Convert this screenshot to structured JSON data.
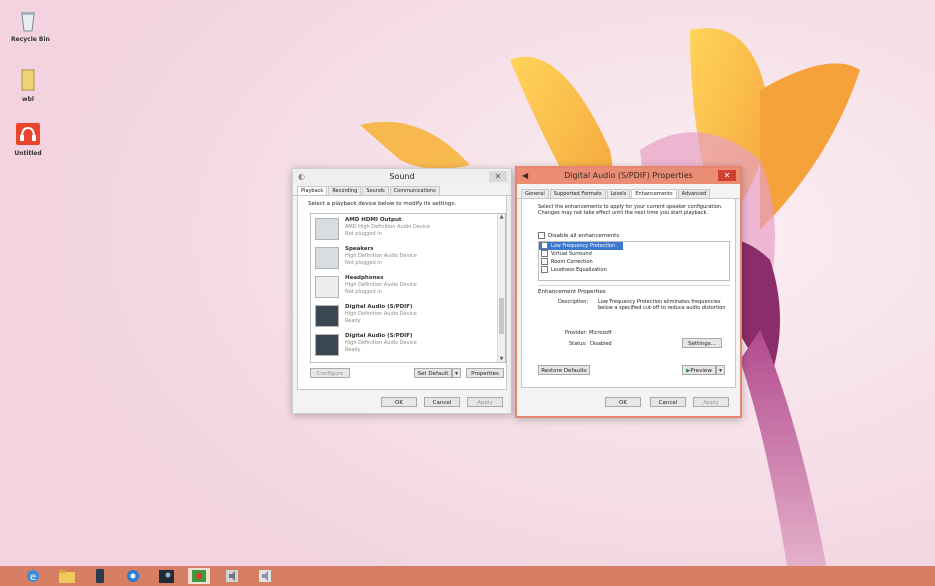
{
  "desktop": {
    "icons": [
      {
        "label": "Recycle Bin",
        "icon": "recycle-bin-icon"
      },
      {
        "label": "wbl",
        "icon": "folder-icon"
      },
      {
        "label": "Untitled",
        "icon": "headphones-app-icon"
      }
    ]
  },
  "sound": {
    "title": "Sound",
    "close_label": "✕",
    "tabs": [
      "Playback",
      "Recording",
      "Sounds",
      "Communications"
    ],
    "instruction": "Select a playback device below to modify its settings:",
    "devices": [
      {
        "name": "AMD HDMI Output",
        "desc": "AMD High Definition Audio Device",
        "status": "Not plugged in",
        "icon": "monitor-icon"
      },
      {
        "name": "Speakers",
        "desc": "High Definition Audio Device",
        "status": "Not plugged in",
        "icon": "speaker-icon"
      },
      {
        "name": "Headphones",
        "desc": "High Definition Audio Device",
        "status": "Not plugged in",
        "icon": "headphones-icon"
      },
      {
        "name": "Digital Audio (S/PDIF)",
        "desc": "High Definition Audio Device",
        "status": "Ready",
        "icon": "spdif-icon"
      },
      {
        "name": "Digital Audio (S/PDIF)",
        "desc": "High Definition Audio Device",
        "status": "Ready",
        "icon": "spdif-icon"
      }
    ],
    "buttons": {
      "configure": "Configure",
      "set_default": "Set Default",
      "properties": "Properties",
      "ok": "OK",
      "cancel": "Cancel",
      "apply": "Apply"
    }
  },
  "props": {
    "title": "Digital Audio (S/PDIF) Properties",
    "close_label": "✕",
    "tabs": [
      "General",
      "Supported Formats",
      "Levels",
      "Enhancements",
      "Advanced"
    ],
    "intro": "Select the enhancements to apply for your current speaker configuration. Changes may not take effect until the next time you start playback.",
    "disable_label": "Disable all enhancements",
    "enhancements": [
      "Low Frequency Protection",
      "Virtual Surround",
      "Room Correction",
      "Loudness Equalization"
    ],
    "group_label": "Enhancement Properties",
    "description_label": "Description:",
    "description": "Low Frequency Protection eliminates frequencies below a specified cut-off to reduce audio distortion",
    "provider_label": "Provider:",
    "provider": "Microsoft",
    "status_label": "Status:",
    "status": "Disabled",
    "buttons": {
      "settings": "Settings...",
      "restore": "Restore Defaults",
      "preview": "Preview",
      "ok": "OK",
      "cancel": "Cancel",
      "apply": "Apply"
    }
  },
  "taskbar": {
    "items": [
      "ie-icon",
      "explorer-icon",
      "phone-icon",
      "app-icon",
      "steam-icon",
      "media-icon",
      "audio-icon",
      "sound-settings-icon"
    ]
  }
}
